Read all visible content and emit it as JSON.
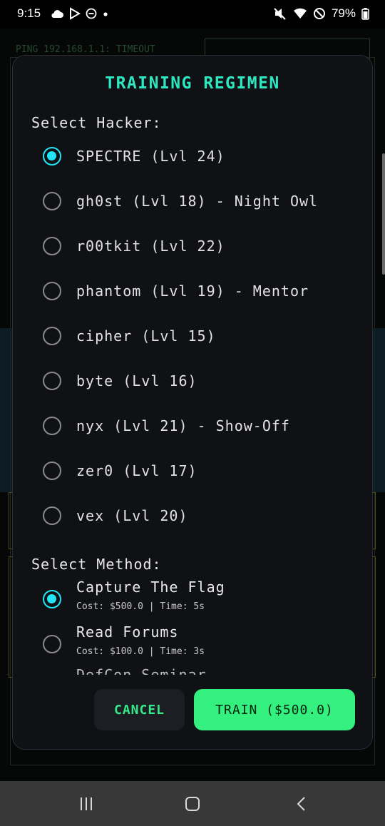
{
  "status_bar": {
    "time": "9:15",
    "battery": "79%",
    "left_icons": [
      "cloud-icon",
      "play-store-icon",
      "dnd-icon",
      "dot-icon"
    ],
    "right_icons": [
      "mute-icon",
      "wifi-icon",
      "no-disturb-icon",
      "battery-icon"
    ]
  },
  "background": {
    "terminal_line": "PING 192.168.1.1: TIMEOUT"
  },
  "dialog": {
    "title": "TRAINING REGIMEN",
    "hacker_label": "Select Hacker:",
    "hackers": [
      {
        "label": "SPECTRE (Lvl 24)",
        "selected": true
      },
      {
        "label": "gh0st (Lvl 18) - Night Owl",
        "selected": false
      },
      {
        "label": "r00tkit (Lvl 22)",
        "selected": false
      },
      {
        "label": "phantom (Lvl 19) - Mentor",
        "selected": false
      },
      {
        "label": "cipher (Lvl 15)",
        "selected": false
      },
      {
        "label": "byte (Lvl 16)",
        "selected": false
      },
      {
        "label": "nyx (Lvl 21) - Show-Off",
        "selected": false
      },
      {
        "label": "zer0 (Lvl 17)",
        "selected": false
      },
      {
        "label": "vex (Lvl 20)",
        "selected": false
      }
    ],
    "method_label": "Select Method:",
    "methods": [
      {
        "name": "Capture The Flag",
        "meta": "Cost: $500.0 | Time: 5s",
        "selected": true
      },
      {
        "name": "Read Forums",
        "meta": "Cost: $100.0 | Time: 3s",
        "selected": false
      },
      {
        "name": "DefCon Seminar",
        "meta": "",
        "selected": false
      }
    ],
    "cancel_label": "CANCEL",
    "train_label": "TRAIN ($500.0)"
  },
  "nav_bar": {
    "buttons": [
      "recent-apps-icon",
      "home-icon",
      "back-icon"
    ]
  },
  "colors": {
    "accent_cyan": "#22e6f5",
    "title_teal": "#2ee6c0",
    "train_green": "#33f07f",
    "cancel_text": "#35e98a",
    "dialog_bg": "#101114"
  }
}
